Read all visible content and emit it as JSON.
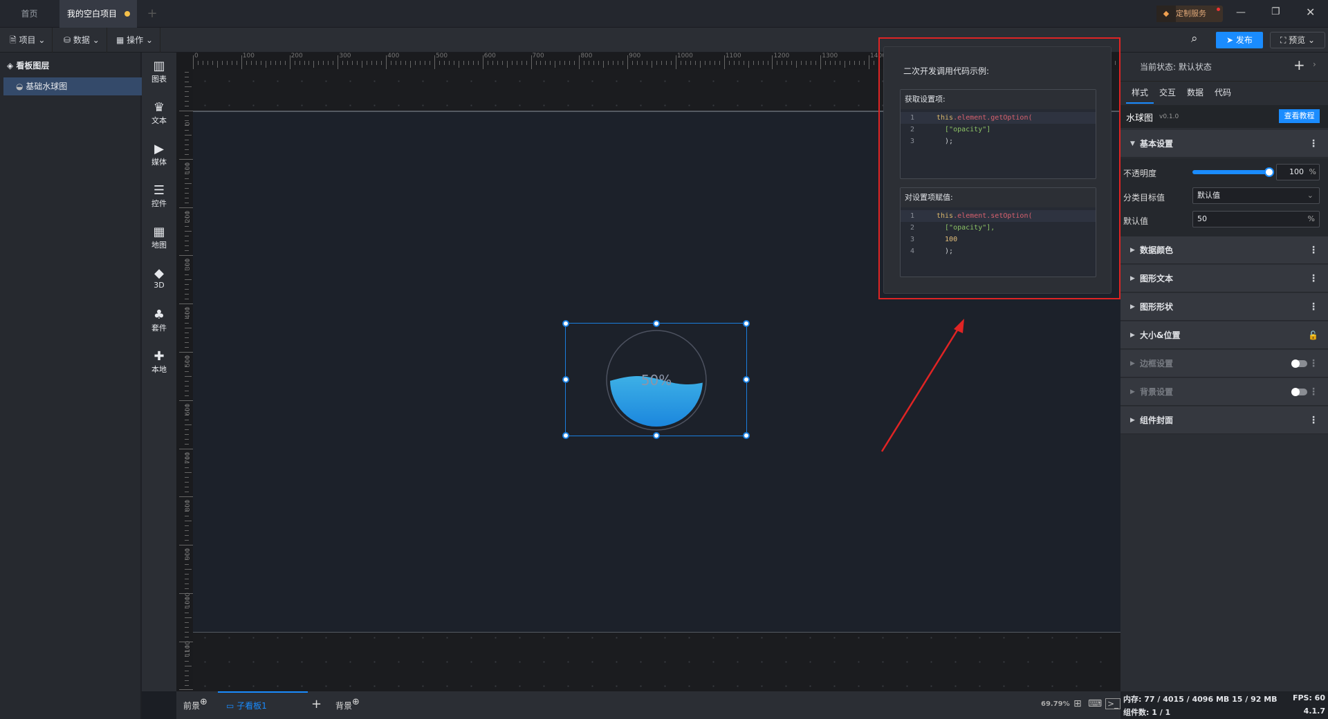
{
  "tabs": {
    "home": "首页",
    "project": "我的空白项目",
    "add": "+"
  },
  "custom_service": "定制服务",
  "toolbar": {
    "project": "项目",
    "data": "数据",
    "operate": "操作",
    "publish": "发布",
    "preview": "预览"
  },
  "layers": {
    "title": "看板图层",
    "items": [
      {
        "label": "基础水球图"
      }
    ]
  },
  "components": [
    {
      "label": "图表",
      "icon": "chart-icon",
      "glyph": "▥"
    },
    {
      "label": "文本",
      "icon": "crown-icon",
      "glyph": "♛"
    },
    {
      "label": "媒体",
      "icon": "camera-icon",
      "glyph": "▶"
    },
    {
      "label": "控件",
      "icon": "list-icon",
      "glyph": "☰"
    },
    {
      "label": "地图",
      "icon": "map-icon",
      "glyph": "▦"
    },
    {
      "label": "3D",
      "icon": "cube-icon",
      "glyph": "◆"
    },
    {
      "label": "套件",
      "icon": "shirt-icon",
      "glyph": "♣"
    },
    {
      "label": "本地",
      "icon": "puzzle-icon",
      "glyph": "✚"
    }
  ],
  "ruler": {
    "h": [
      "0",
      "100",
      "200",
      "300",
      "400",
      "500",
      "600",
      "700",
      "800",
      "900",
      "1000",
      "1100",
      "1200",
      "1300",
      "1400"
    ],
    "v": [
      "0",
      "100",
      "200",
      "300",
      "400",
      "500",
      "600",
      "700",
      "800",
      "900",
      "1000",
      "1100"
    ]
  },
  "widget": {
    "value_text": "50%",
    "value": 50
  },
  "bottom": {
    "foreground": "前景",
    "board": "子看板1",
    "add": "+",
    "background": "背景",
    "zoom": "69.79%"
  },
  "status": {
    "memory": "内存: 77 / 4015 / 4096 MB  15 / 92 MB",
    "fps": "FPS:  60",
    "components": "组件数: 1 / 1",
    "version": "4.1.7"
  },
  "popup": {
    "title": "二次开发调用代码示例:",
    "get": {
      "header": "获取设置项:",
      "lines": [
        [
          "1",
          "this",
          ".element.getOption("
        ],
        [
          "2",
          "",
          "  [\"opacity\"]"
        ],
        [
          "3",
          "",
          "  );"
        ]
      ]
    },
    "set": {
      "header": "对设置项赋值:",
      "lines": [
        [
          "1",
          "this",
          ".element.setOption("
        ],
        [
          "2",
          "",
          "  [\"opacity\"],"
        ],
        [
          "3",
          "",
          "  100"
        ],
        [
          "4",
          "",
          "  );"
        ]
      ]
    }
  },
  "panel": {
    "state_label": "当前状态:",
    "state_value": "默认状态",
    "tabs": [
      "样式",
      "交互",
      "数据",
      "代码"
    ],
    "component_name": "水球图",
    "version": "v0.1.0",
    "tutorial": "查看教程",
    "basic": "基本设置",
    "opacity_label": "不透明度",
    "opacity_value": "100",
    "opacity_percent": 100,
    "unit": "%",
    "category_label": "分类目标值",
    "category_value": "默认值",
    "default_label": "默认值",
    "default_value": "50",
    "sections": [
      "数据颜色",
      "图形文本",
      "图形形状",
      "大小&位置",
      "边框设置",
      "背景设置",
      "组件封面"
    ]
  },
  "colors": {
    "accent": "#1a8cff",
    "red": "#e02424"
  }
}
